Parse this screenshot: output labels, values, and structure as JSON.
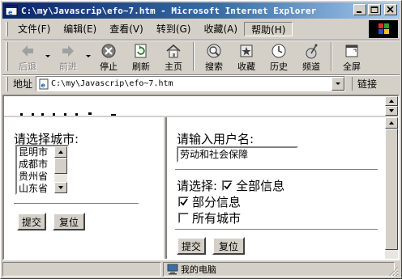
{
  "window": {
    "title": "C:\\my\\Javascrip\\efo~7.htm - Microsoft Internet Explorer"
  },
  "menu": [
    "文件(F)",
    "编辑(E)",
    "查看(V)",
    "转到(G)",
    "收藏(A)",
    "帮助(H)"
  ],
  "toolbar": {
    "back": "后退",
    "forward": "前进",
    "stop": "停止",
    "refresh": "刷新",
    "home": "主页",
    "search": "搜索",
    "favorites": "收藏",
    "history": "历史",
    "channels": "频道",
    "fullscreen": "全屏"
  },
  "address": {
    "label": "地址",
    "url": "C:\\my\\Javascrip\\efo~7.htm",
    "links": "链接"
  },
  "left_frame": {
    "city_label": "请选择城市:",
    "cities": [
      "昆明市",
      "成都市",
      "贵州省",
      "山东省"
    ],
    "submit": "提交",
    "reset": "复位"
  },
  "right_frame": {
    "user_label": "请输入用户名:",
    "user_value": "劳动和社会保障",
    "choose_label": "请选择:",
    "options": [
      {
        "label": "全部信息",
        "checked": true
      },
      {
        "label": "部分信息",
        "checked": true
      },
      {
        "label": "所有城市",
        "checked": false
      }
    ],
    "submit": "提交",
    "reset": "复位"
  },
  "status": {
    "zone": "我的电脑"
  },
  "colors": {
    "title_start": "#0a246a",
    "title_end": "#a6caf0",
    "face": "#d4d0c8"
  }
}
